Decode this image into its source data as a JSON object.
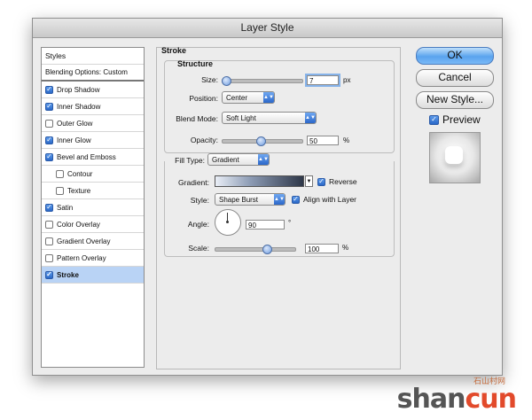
{
  "window": {
    "title": "Layer Style"
  },
  "styles_panel": {
    "header": "Styles",
    "blending": "Blending Options: Custom",
    "items": [
      {
        "label": "Drop Shadow",
        "checked": true
      },
      {
        "label": "Inner Shadow",
        "checked": true
      },
      {
        "label": "Outer Glow",
        "checked": false
      },
      {
        "label": "Inner Glow",
        "checked": true
      },
      {
        "label": "Bevel and Emboss",
        "checked": true
      },
      {
        "label": "Contour",
        "checked": false
      },
      {
        "label": "Texture",
        "checked": false
      },
      {
        "label": "Satin",
        "checked": true
      },
      {
        "label": "Color Overlay",
        "checked": false
      },
      {
        "label": "Gradient Overlay",
        "checked": false
      },
      {
        "label": "Pattern Overlay",
        "checked": false
      },
      {
        "label": "Stroke",
        "checked": true
      }
    ]
  },
  "stroke": {
    "title": "Stroke",
    "structure_title": "Structure",
    "size_label": "Size:",
    "size_value": "7",
    "size_unit": "px",
    "position_label": "Position:",
    "position_value": "Center",
    "blend_label": "Blend Mode:",
    "blend_value": "Soft Light",
    "opacity_label": "Opacity:",
    "opacity_value": "50",
    "opacity_unit": "%",
    "filltype_label": "Fill Type:",
    "filltype_value": "Gradient",
    "gradient_label": "Gradient:",
    "reverse_label": "Reverse",
    "style_label": "Style:",
    "style_value": "Shape Burst",
    "align_label": "Align with Layer",
    "angle_label": "Angle:",
    "angle_value": "90",
    "angle_unit": "°",
    "scale_label": "Scale:",
    "scale_value": "100",
    "scale_unit": "%"
  },
  "buttons": {
    "ok": "OK",
    "cancel": "Cancel",
    "new_style": "New Style...",
    "preview": "Preview"
  },
  "watermark": {
    "text1": "shan",
    "text2": "cun",
    "small": "石山村网"
  },
  "colors": {
    "selection": "#b9d3f5",
    "accent": "#2a68c8"
  }
}
